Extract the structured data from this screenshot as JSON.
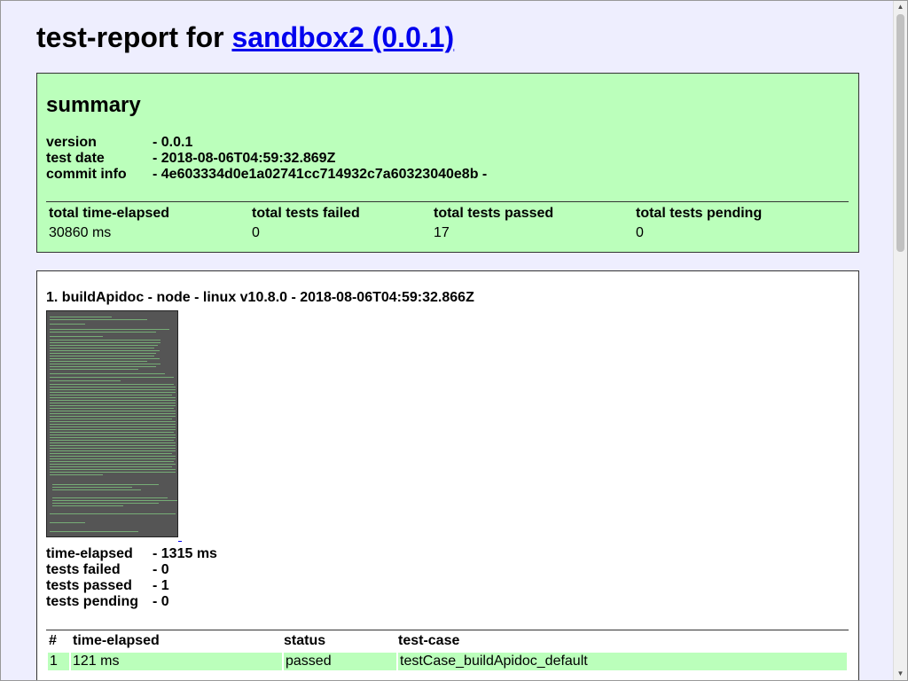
{
  "header": {
    "title_prefix": "test-report for",
    "title_link": "sandbox2 (0.0.1)"
  },
  "summary": {
    "heading": "summary",
    "fields": [
      {
        "key": "version",
        "value": "- 0.0.1"
      },
      {
        "key": "test date",
        "value": "- 2018-08-06T04:59:32.869Z"
      },
      {
        "key": "commit info",
        "value": "- 4e603334d0e1a02741cc714932c7a60323040e8b -"
      }
    ],
    "totals": {
      "headers": [
        "total time-elapsed",
        "total tests failed",
        "total tests passed",
        "total tests pending"
      ],
      "values": [
        "30860 ms",
        "0",
        "17",
        "0"
      ]
    }
  },
  "tests": [
    {
      "title": "1. buildApidoc - node - linux v10.8.0 - 2018-08-06T04:59:32.866Z",
      "screenshot_alt": "screenshot",
      "stats": [
        {
          "key": "time-elapsed",
          "value": "- 1315 ms"
        },
        {
          "key": "tests failed",
          "value": "- 0"
        },
        {
          "key": "tests passed",
          "value": "- 1"
        },
        {
          "key": "tests pending",
          "value": "- 0"
        }
      ],
      "case_table": {
        "headers": [
          "#",
          "time-elapsed",
          "status",
          "test-case"
        ],
        "rows": [
          [
            "1",
            "121 ms",
            "passed",
            "testCase_buildApidoc_default"
          ]
        ]
      }
    }
  ],
  "colors": {
    "background": "#eeeefe",
    "summary_bg": "#bbffbb",
    "passed_row_bg": "#bbffbb",
    "link": "#0000ee"
  },
  "scrollbar": {
    "up_icon": "triangle-up-icon",
    "down_icon": "triangle-down-icon"
  }
}
